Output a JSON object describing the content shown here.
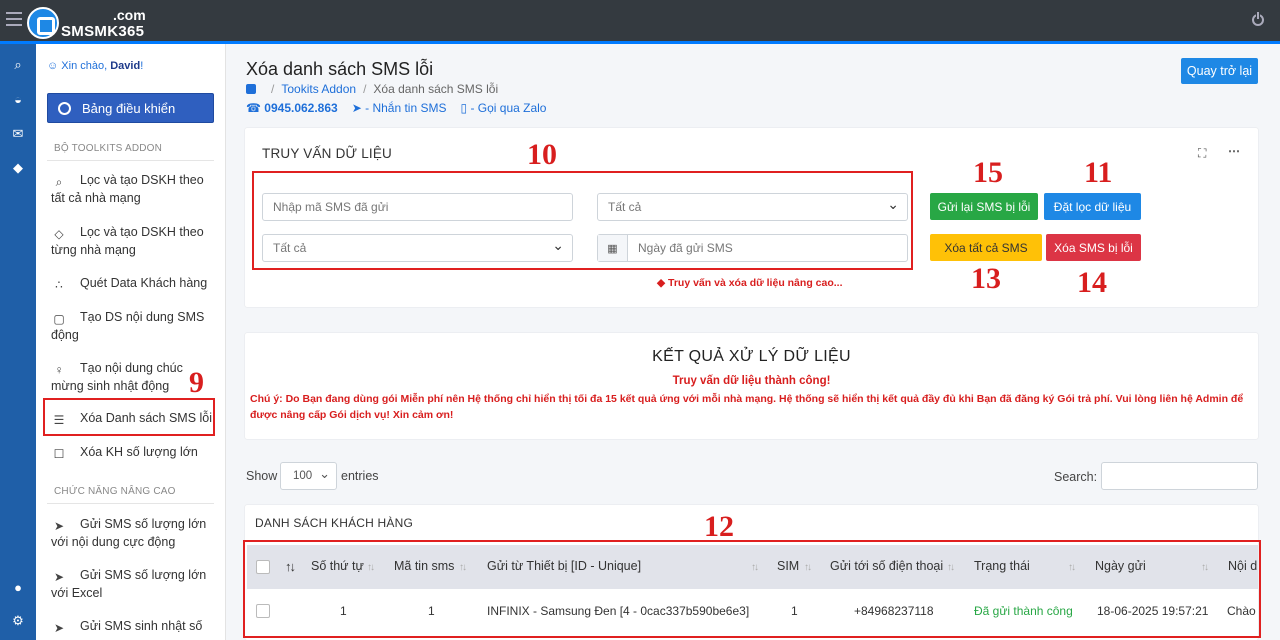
{
  "brand": {
    "top": ".com",
    "name": "SMSMK365"
  },
  "sidebar": {
    "greeting_prefix": "Xin chào, ",
    "user": "David",
    "greeting_suffix": "!",
    "dashboard": "Bảng điều khiển",
    "section1": "BỘ TOOLKITS ADDON",
    "section2": "CHỨC NĂNG NÂNG CAO",
    "items": [
      {
        "label": "Lọc và tạo DSKH theo tất cả nhà mạng",
        "icon": "search-icon"
      },
      {
        "label": "Lọc và tạo DSKH theo từng nhà mạng",
        "icon": "tag-icon"
      },
      {
        "label": "Quét Data Khách hàng",
        "icon": "share-icon"
      },
      {
        "label": "Tạo DS nội dung SMS động",
        "icon": "chat-icon"
      },
      {
        "label": "Tạo nội dung chúc mừng sinh nhật động",
        "icon": "user-icon"
      },
      {
        "label": "Xóa Danh sách SMS lỗi",
        "icon": "list-icon"
      },
      {
        "label": "Xóa KH số lượng lớn",
        "icon": "trash-icon"
      }
    ],
    "items2": [
      {
        "label": "Gửi SMS số lượng lớn với nội dung cực động",
        "icon": "send-icon"
      },
      {
        "label": "Gửi SMS số lượng lớn với Excel",
        "icon": "send-icon"
      },
      {
        "label": "Gửi SMS sinh nhật số",
        "icon": "send-icon"
      }
    ]
  },
  "header": {
    "title": "Xóa danh sách SMS lỗi",
    "crumb1": "Tookits Addon",
    "crumb2": "Xóa danh sách SMS lỗi",
    "phone": "0945.062.863",
    "sms": "- Nhắn tin SMS",
    "zalo": "- Gọi qua Zalo",
    "back": "Quay trở lại"
  },
  "query": {
    "title": "TRUY VẤN DỮ LIỆU",
    "sms_code_placeholder": "Nhập mã SMS đã gửi",
    "select1": "Tất cả",
    "select2": "Tất cả",
    "date_placeholder": "Ngày đã gửi SMS",
    "advanced": "Truy vấn và xóa dữ liệu nâng cao...",
    "btn_resend": "Gửi lại SMS bị lỗi",
    "btn_filter": "Đặt lọc dữ liệu",
    "btn_delete_all": "Xóa tất cả SMS",
    "btn_delete_err": "Xóa SMS bị lỗi"
  },
  "annotations": {
    "a9": "9",
    "a10": "10",
    "a11": "11",
    "a12": "12",
    "a13": "13",
    "a14": "14",
    "a15": "15"
  },
  "result": {
    "title": "KẾT QUẢ XỬ LÝ DỮ LIỆU",
    "success": "Truy vấn dữ liệu thành công!",
    "note": "Chú ý: Do Bạn đang dùng gói Miễn phí nên Hệ thống chỉ hiển thị tối đa 15 kết quả ứng với mỗi nhà mạng. Hệ thống sẽ hiển thị kết quả đầy đủ khi Bạn đã đăng ký Gói trả phí. Vui lòng liên hệ Admin để được nâng cấp Gói dịch vụ! Xin cảm ơn!"
  },
  "table": {
    "show": "Show",
    "page_size": "100",
    "entries": "entries",
    "search": "Search:",
    "card_title": "DANH SÁCH KHÁCH HÀNG",
    "columns": [
      "Số thứ tự",
      "Mã tin sms",
      "Gửi từ Thiết bị [ID - Unique]",
      "SIM",
      "Gửi tới số điện thoại",
      "Trạng thái",
      "Ngày gửi",
      "Nội d"
    ],
    "rows": [
      {
        "stt": "1",
        "code": "1",
        "device": "INFINIX - Samsung Đen [4 - 0cac337b590be6e3]",
        "sim": "1",
        "phone": "+84968237118",
        "status": "Đã gửi thành công",
        "date": "18-06-2025 19:57:21",
        "content": "Chào"
      }
    ]
  },
  "colors": {
    "primary": "#1e88e5",
    "success": "#28a745",
    "warning": "#ffc107",
    "danger": "#dc3545",
    "annotation": "#e02020"
  }
}
